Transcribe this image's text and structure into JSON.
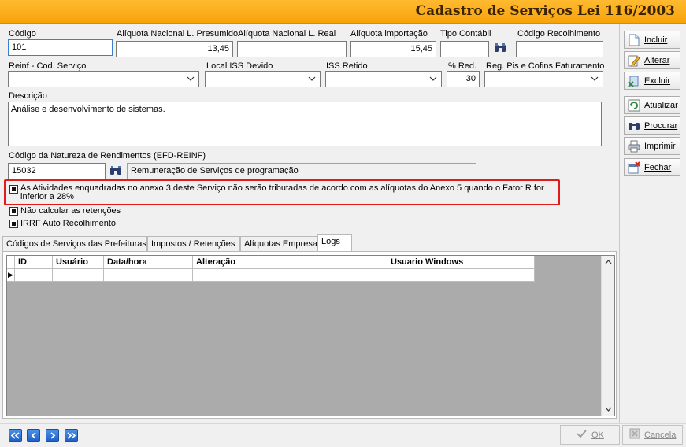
{
  "window": {
    "title": "Cadastro de Serviços Lei 116/2003"
  },
  "form": {
    "codigo": {
      "label": "Código",
      "value": "101"
    },
    "aliq_presumido": {
      "label": "Alíquota Nacional L. Presumido",
      "value": "13,45"
    },
    "aliq_real": {
      "label": "Alíquota Nacional L. Real",
      "value": ""
    },
    "aliq_importacao": {
      "label": "Alíquota importação",
      "value": "15,45"
    },
    "tipo_contabil": {
      "label": "Tipo Contábil",
      "value": ""
    },
    "codigo_recolhimento": {
      "label": "Código Recolhimento",
      "value": ""
    },
    "reinf_cod_servico": {
      "label": "Reinf - Cod. Serviço",
      "value": ""
    },
    "local_iss": {
      "label": "Local ISS Devido",
      "value": ""
    },
    "iss_retido": {
      "label": "ISS Retido",
      "value": ""
    },
    "pct_red": {
      "label": "% Red.",
      "value": "30"
    },
    "reg_pis_cofins": {
      "label": "Reg. Pis e Cofins Faturamento",
      "value": ""
    },
    "descricao": {
      "label": "Descrição",
      "value": "Análise e desenvolvimento de sistemas."
    },
    "natureza": {
      "label": "Código da Natureza de Rendimentos (EFD-REINF)",
      "code": "15032",
      "description": "Remuneração de Serviços de programação"
    }
  },
  "checkboxes": {
    "anexo3": "As Atividades enquadradas no anexo 3 deste Serviço não serão tributadas de acordo com as alíquotas do Anexo 5 quando o Fator R for inferior a 28%",
    "nao_calcular": "Não calcular as retenções",
    "irrf_auto": "IRRF Auto Recolhimento"
  },
  "tabs": [
    {
      "label": "Códigos de Serviços das Prefeituras"
    },
    {
      "label": "Impostos / Retenções"
    },
    {
      "label": "Alíquotas Empresa"
    },
    {
      "label": "Logs"
    }
  ],
  "grid": {
    "columns": [
      "ID",
      "Usuário",
      "Data/hora",
      "Alteração",
      "Usuario Windows"
    ],
    "row_indicator": "▶"
  },
  "actions": {
    "incluir": "Incluir",
    "alterar": "Alterar",
    "excluir": "Excluir",
    "atualizar": "Atualizar",
    "procurar": "Procurar",
    "imprimir": "Imprimir",
    "fechar": "Fechar"
  },
  "footer": {
    "ok": "OK",
    "cancela": "Cancela"
  },
  "colors": {
    "title_bar": "#f7a30b",
    "highlight_border": "#e11b1b",
    "nav_blue": "#1f5fc4"
  }
}
